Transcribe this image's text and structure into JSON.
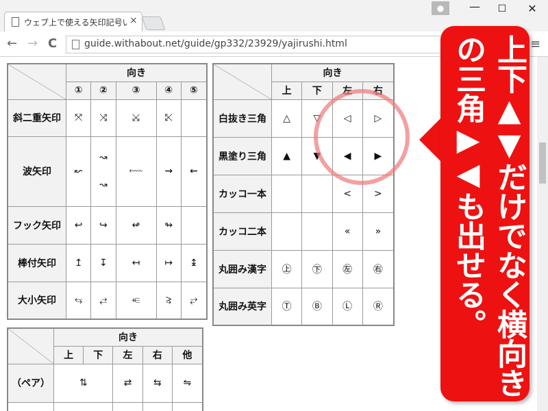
{
  "browser": {
    "tab_title": "ウェブ上で使える矢印記号い",
    "tab_close": "×",
    "url": "guide.withabout.net/guide/gp332/23929/yajirushi.html",
    "back": "←",
    "forward": "→",
    "reload": "C",
    "menu": "≡",
    "user_icon": "●",
    "win_min": "—",
    "win_max": "☐",
    "win_close": "✕"
  },
  "table1": {
    "header": "向き",
    "cols": [
      "①",
      "②",
      "③",
      "④",
      "⑤"
    ],
    "rows": [
      {
        "label": "斜二重矢印",
        "cells": [
          "⤧",
          "⤨",
          "⤩",
          "⤪",
          ""
        ]
      },
      {
        "label": "波矢印",
        "cells": [
          "↜",
          "↝\n↝",
          "⬳",
          "⇝",
          "⇜"
        ]
      },
      {
        "label": "フック矢印",
        "cells": [
          "↩",
          "↪",
          "↫",
          "↬",
          ""
        ]
      },
      {
        "label": "棒付矢印",
        "cells": [
          "↥",
          "↧",
          "↤",
          "↦",
          "↨"
        ]
      },
      {
        "label": "大小矢印",
        "cells": [
          "⥃",
          "⥄",
          "⥺",
          "⥸",
          "⥂"
        ]
      }
    ]
  },
  "table2": {
    "header": "向き",
    "cols": [
      "上",
      "下",
      "左",
      "右"
    ],
    "rows": [
      {
        "label": "白抜き三角",
        "cells": [
          "△",
          "▽",
          "◁",
          "▷"
        ]
      },
      {
        "label": "黒塗り三角",
        "cells": [
          "▲",
          "▼",
          "◀",
          "▶"
        ]
      },
      {
        "label": "カッコ一本",
        "cells": [
          "",
          "",
          "<",
          ">"
        ]
      },
      {
        "label": "カッコ二本",
        "cells": [
          "",
          "",
          "«",
          "»"
        ]
      },
      {
        "label": "丸囲み漢字",
        "cells": [
          "㊤",
          "㊦",
          "㊧",
          "㊨"
        ]
      },
      {
        "label": "丸囲み英字",
        "cells": [
          "Ⓣ",
          "Ⓑ",
          "Ⓛ",
          "Ⓡ"
        ]
      }
    ]
  },
  "table3": {
    "header": "向き",
    "cols": [
      "上",
      "下",
      "左",
      "右",
      "他"
    ],
    "row_label": "（ペア）",
    "cells": [
      "⇅",
      "⇄",
      "⇆",
      "⇋"
    ]
  },
  "callout": {
    "text": "上下▲▼だけでなく横向きの三角▶◀も出せる。",
    "color": "#ee1111"
  }
}
